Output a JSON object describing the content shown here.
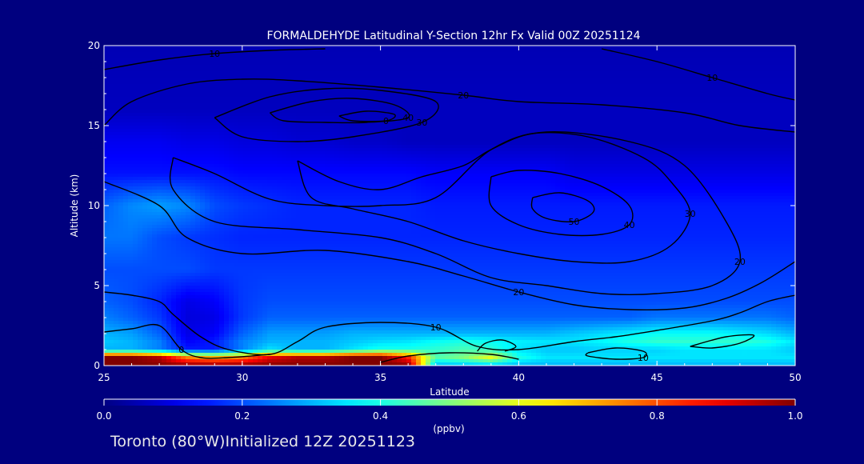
{
  "chart_data": {
    "type": "heatmap",
    "title": "FORMALDEHYDE Latitudinal Y-Section 12hr  Fx Valid 00Z 20251124",
    "xlabel": "Latitude",
    "ylabel": "Altitude (km)",
    "xlim": [
      25,
      50
    ],
    "ylim": [
      0,
      20
    ],
    "x_ticks": [
      "25",
      "30",
      "35",
      "40",
      "45",
      "50"
    ],
    "y_ticks": [
      "0",
      "5",
      "10",
      "15",
      "20"
    ],
    "x_tick_values": [
      25,
      30,
      35,
      40,
      45,
      50
    ],
    "y_tick_values": [
      0,
      5,
      10,
      15,
      20
    ],
    "colorbar": {
      "range": [
        0.0,
        1.0
      ],
      "ticks": [
        "0.0",
        "0.2",
        "0.4",
        "0.6",
        "0.8",
        "1.0"
      ],
      "tick_values": [
        0.0,
        0.2,
        0.4,
        0.6,
        0.8,
        1.0
      ],
      "unit_label": "(ppbv)"
    },
    "field": {
      "lat": [
        25,
        26,
        27,
        28,
        29,
        30,
        31,
        32,
        33,
        34,
        35,
        36,
        37,
        38,
        39,
        40,
        41,
        42,
        43,
        44,
        45,
        46,
        47,
        48,
        49,
        50
      ],
      "alt": [
        0,
        0.5,
        1,
        1.5,
        2,
        3,
        4,
        6,
        8,
        10,
        12,
        14,
        16,
        20
      ],
      "values": [
        [
          1.0,
          1.0,
          1.0,
          1.0,
          1.0,
          1.0,
          1.0,
          1.0,
          1.0,
          1.0,
          1.0,
          1.0,
          0.3,
          0.3,
          0.3,
          0.3,
          0.3,
          0.3,
          0.3,
          0.3,
          0.3,
          0.3,
          0.3,
          0.3,
          0.3,
          0.3
        ],
        [
          1.0,
          1.0,
          0.95,
          0.75,
          0.7,
          0.75,
          0.9,
          0.95,
          0.95,
          1.0,
          1.0,
          0.85,
          0.45,
          0.5,
          0.6,
          0.4,
          0.35,
          0.35,
          0.35,
          0.35,
          0.35,
          0.35,
          0.35,
          0.35,
          0.35,
          0.35
        ],
        [
          0.3,
          0.3,
          0.25,
          0.15,
          0.15,
          0.25,
          0.35,
          0.3,
          0.3,
          0.35,
          0.4,
          0.4,
          0.42,
          0.45,
          0.42,
          0.35,
          0.32,
          0.32,
          0.33,
          0.33,
          0.33,
          0.35,
          0.35,
          0.35,
          0.35,
          0.32
        ],
        [
          0.32,
          0.3,
          0.25,
          0.12,
          0.15,
          0.25,
          0.3,
          0.3,
          0.3,
          0.32,
          0.34,
          0.35,
          0.38,
          0.4,
          0.38,
          0.36,
          0.35,
          0.35,
          0.37,
          0.4,
          0.42,
          0.42,
          0.42,
          0.42,
          0.4,
          0.35
        ],
        [
          0.3,
          0.28,
          0.22,
          0.1,
          0.12,
          0.22,
          0.28,
          0.28,
          0.28,
          0.3,
          0.3,
          0.3,
          0.3,
          0.3,
          0.3,
          0.3,
          0.3,
          0.32,
          0.34,
          0.36,
          0.38,
          0.38,
          0.38,
          0.36,
          0.34,
          0.3
        ],
        [
          0.25,
          0.22,
          0.18,
          0.09,
          0.1,
          0.18,
          0.22,
          0.22,
          0.22,
          0.22,
          0.22,
          0.22,
          0.22,
          0.22,
          0.22,
          0.22,
          0.22,
          0.22,
          0.22,
          0.22,
          0.24,
          0.24,
          0.24,
          0.24,
          0.24,
          0.22
        ],
        [
          0.22,
          0.2,
          0.16,
          0.1,
          0.12,
          0.18,
          0.2,
          0.2,
          0.2,
          0.2,
          0.2,
          0.2,
          0.2,
          0.2,
          0.2,
          0.2,
          0.2,
          0.2,
          0.2,
          0.2,
          0.2,
          0.2,
          0.2,
          0.2,
          0.2,
          0.2
        ],
        [
          0.2,
          0.2,
          0.2,
          0.2,
          0.18,
          0.18,
          0.18,
          0.18,
          0.18,
          0.18,
          0.18,
          0.18,
          0.18,
          0.18,
          0.18,
          0.18,
          0.18,
          0.18,
          0.18,
          0.18,
          0.18,
          0.18,
          0.18,
          0.18,
          0.18,
          0.18
        ],
        [
          0.24,
          0.24,
          0.2,
          0.18,
          0.17,
          0.16,
          0.16,
          0.16,
          0.16,
          0.16,
          0.16,
          0.16,
          0.16,
          0.16,
          0.16,
          0.16,
          0.16,
          0.16,
          0.16,
          0.16,
          0.16,
          0.16,
          0.16,
          0.16,
          0.16,
          0.16
        ],
        [
          0.22,
          0.26,
          0.28,
          0.26,
          0.2,
          0.18,
          0.17,
          0.16,
          0.16,
          0.16,
          0.16,
          0.16,
          0.15,
          0.15,
          0.15,
          0.15,
          0.15,
          0.15,
          0.15,
          0.15,
          0.15,
          0.15,
          0.15,
          0.15,
          0.15,
          0.15
        ],
        [
          0.14,
          0.14,
          0.14,
          0.14,
          0.14,
          0.13,
          0.13,
          0.13,
          0.13,
          0.13,
          0.13,
          0.13,
          0.12,
          0.12,
          0.12,
          0.12,
          0.12,
          0.1,
          0.1,
          0.1,
          0.1,
          0.1,
          0.1,
          0.1,
          0.1,
          0.1
        ],
        [
          0.11,
          0.11,
          0.11,
          0.1,
          0.1,
          0.09,
          0.09,
          0.08,
          0.08,
          0.07,
          0.07,
          0.06,
          0.06,
          0.06,
          0.06,
          0.06,
          0.06,
          0.06,
          0.06,
          0.06,
          0.06,
          0.06,
          0.06,
          0.06,
          0.06,
          0.06
        ],
        [
          0.06,
          0.06,
          0.06,
          0.06,
          0.06,
          0.06,
          0.06,
          0.06,
          0.06,
          0.06,
          0.06,
          0.06,
          0.06,
          0.06,
          0.06,
          0.06,
          0.06,
          0.06,
          0.06,
          0.06,
          0.06,
          0.06,
          0.06,
          0.06,
          0.06,
          0.06
        ],
        [
          0.05,
          0.05,
          0.05,
          0.05,
          0.05,
          0.05,
          0.05,
          0.05,
          0.05,
          0.05,
          0.05,
          0.05,
          0.05,
          0.05,
          0.05,
          0.05,
          0.05,
          0.05,
          0.05,
          0.05,
          0.05,
          0.05,
          0.05,
          0.05,
          0.05,
          0.05
        ]
      ]
    },
    "contours": [
      {
        "label": "0",
        "points": [
          [
            25,
            2.1
          ],
          [
            26,
            2.3
          ],
          [
            27,
            2.5
          ],
          [
            27.8,
            1.0
          ],
          [
            28.5,
            0.5
          ],
          [
            29.5,
            0.5
          ],
          [
            31,
            0.7
          ]
        ]
      },
      {
        "label": "10",
        "points": [
          [
            25,
            4.6
          ],
          [
            26,
            4.4
          ],
          [
            27,
            4.0
          ],
          [
            27.5,
            3.2
          ],
          [
            28.5,
            1.8
          ],
          [
            29.5,
            1.0
          ],
          [
            31,
            0.7
          ],
          [
            32,
            1.5
          ],
          [
            33,
            2.4
          ],
          [
            35,
            2.7
          ],
          [
            37,
            2.4
          ],
          [
            38.5,
            1.2
          ],
          [
            40,
            1.0
          ],
          [
            42,
            1.5
          ],
          [
            43.5,
            1.8
          ],
          [
            45,
            2.2
          ],
          [
            47,
            2.8
          ],
          [
            48,
            3.3
          ],
          [
            49,
            4.0
          ],
          [
            50,
            4.4
          ]
        ]
      },
      {
        "label": "10",
        "points": [
          [
            25,
            18.5
          ],
          [
            27,
            19.1
          ],
          [
            29,
            19.5
          ],
          [
            31,
            19.7
          ],
          [
            33,
            19.8
          ]
        ]
      },
      {
        "label": "10",
        "points": [
          [
            43,
            19.8
          ],
          [
            45,
            19.0
          ],
          [
            47,
            18.0
          ],
          [
            49,
            17.0
          ],
          [
            50,
            16.6
          ]
        ]
      },
      {
        "label": "20",
        "points": [
          [
            25,
            11.5
          ],
          [
            27,
            10.0
          ],
          [
            28,
            8.0
          ],
          [
            30,
            7.0
          ],
          [
            33,
            7.2
          ],
          [
            36,
            6.5
          ],
          [
            38,
            5.6
          ],
          [
            40,
            4.6
          ],
          [
            42,
            3.8
          ],
          [
            44,
            3.5
          ],
          [
            46,
            3.6
          ],
          [
            47.5,
            4.2
          ],
          [
            48.8,
            5.2
          ],
          [
            50,
            6.5
          ]
        ]
      },
      {
        "label": "20",
        "points": [
          [
            25,
            15.0
          ],
          [
            26,
            16.5
          ],
          [
            28,
            17.6
          ],
          [
            30,
            17.9
          ],
          [
            32,
            17.8
          ],
          [
            35,
            17.4
          ],
          [
            38,
            16.9
          ],
          [
            40,
            16.5
          ],
          [
            43,
            16.3
          ],
          [
            46,
            15.8
          ],
          [
            48,
            15.0
          ],
          [
            50,
            14.6
          ]
        ]
      },
      {
        "label": "20",
        "points": [
          [
            27.5,
            13.0
          ],
          [
            29,
            12.0
          ],
          [
            31,
            10.4
          ],
          [
            33,
            10.0
          ],
          [
            35,
            10.0
          ],
          [
            37,
            10.5
          ],
          [
            39,
            13.5
          ],
          [
            41,
            14.6
          ],
          [
            44,
            14.0
          ],
          [
            46,
            12.5
          ],
          [
            47.5,
            9.0
          ],
          [
            48,
            6.5
          ],
          [
            47,
            5.0
          ],
          [
            45,
            4.5
          ],
          [
            43,
            4.5
          ],
          [
            41,
            5.0
          ],
          [
            39,
            5.5
          ],
          [
            37,
            7.0
          ],
          [
            35,
            8.0
          ],
          [
            32,
            8.5
          ],
          [
            29,
            9.0
          ],
          [
            27.5,
            11.0
          ],
          [
            27.5,
            13.0
          ]
        ]
      },
      {
        "label": "30",
        "points": [
          [
            32,
            12.8
          ],
          [
            33.5,
            11.5
          ],
          [
            35,
            11.0
          ],
          [
            36.5,
            11.8
          ],
          [
            38,
            12.5
          ],
          [
            39,
            13.5
          ],
          [
            40.5,
            14.5
          ],
          [
            42.5,
            14.3
          ],
          [
            44.5,
            13.0
          ],
          [
            45.5,
            11.5
          ],
          [
            46.2,
            9.5
          ],
          [
            45.5,
            7.5
          ],
          [
            44,
            6.5
          ],
          [
            42,
            6.5
          ],
          [
            40,
            7.0
          ],
          [
            38,
            7.8
          ],
          [
            36,
            9.0
          ],
          [
            34,
            9.8
          ],
          [
            32.5,
            10.5
          ],
          [
            32,
            12.8
          ]
        ]
      },
      {
        "label": "30",
        "points": [
          [
            29,
            15.5
          ],
          [
            31,
            16.8
          ],
          [
            33,
            17.3
          ],
          [
            35,
            17.2
          ],
          [
            37,
            16.5
          ],
          [
            36.5,
            15.2
          ],
          [
            34,
            14.3
          ],
          [
            32,
            14.0
          ],
          [
            30,
            14.3
          ],
          [
            29,
            15.5
          ]
        ]
      },
      {
        "label": "40",
        "points": [
          [
            39,
            11.8
          ],
          [
            40,
            12.2
          ],
          [
            41.5,
            12.0
          ],
          [
            43,
            11.2
          ],
          [
            44,
            10.0
          ],
          [
            44,
            8.8
          ],
          [
            43,
            8.2
          ],
          [
            41.5,
            8.2
          ],
          [
            40,
            8.8
          ],
          [
            39,
            10.0
          ],
          [
            39,
            11.8
          ]
        ]
      },
      {
        "label": "40",
        "points": [
          [
            31,
            15.8
          ],
          [
            32.5,
            16.5
          ],
          [
            34,
            16.7
          ],
          [
            35.5,
            16.3
          ],
          [
            36,
            15.5
          ],
          [
            34.5,
            15.2
          ],
          [
            33,
            15.2
          ],
          [
            31.5,
            15.3
          ],
          [
            31,
            15.8
          ]
        ]
      },
      {
        "label": "50",
        "points": [
          [
            40.5,
            10.5
          ],
          [
            41.5,
            10.8
          ],
          [
            42.5,
            10.3
          ],
          [
            42.7,
            9.6
          ],
          [
            42,
            9.0
          ],
          [
            41,
            9.2
          ],
          [
            40.5,
            9.8
          ],
          [
            40.5,
            10.5
          ]
        ]
      },
      {
        "label": "0",
        "points": [
          [
            33.5,
            15.6
          ],
          [
            34.5,
            15.9
          ],
          [
            35.5,
            15.7
          ],
          [
            35.2,
            15.3
          ],
          [
            34,
            15.3
          ],
          [
            33.5,
            15.6
          ]
        ]
      },
      {
        "label": "10",
        "points": [
          [
            42.5,
            0.8
          ],
          [
            43.5,
            1.1
          ],
          [
            44.5,
            0.9
          ],
          [
            44.5,
            0.5
          ],
          [
            43.5,
            0.4
          ],
          [
            42.5,
            0.6
          ],
          [
            42.5,
            0.8
          ]
        ]
      },
      {
        "label": "",
        "points": [
          [
            46.2,
            1.2
          ],
          [
            47.5,
            1.8
          ],
          [
            48.5,
            1.9
          ],
          [
            48,
            1.4
          ],
          [
            47,
            1.1
          ],
          [
            46.2,
            1.2
          ]
        ]
      },
      {
        "label": "",
        "points": [
          [
            35,
            0.2
          ],
          [
            36,
            0.6
          ],
          [
            37.5,
            0.8
          ],
          [
            39,
            0.7
          ],
          [
            40,
            0.4
          ]
        ]
      },
      {
        "label": "",
        "points": [
          [
            38.5,
            0.9
          ],
          [
            38.8,
            1.4
          ],
          [
            39.4,
            1.6
          ],
          [
            39.9,
            1.2
          ],
          [
            39.5,
            0.9
          ]
        ]
      }
    ]
  },
  "footer": {
    "location": "Toronto (80°W)",
    "initialized": "Initialized 12Z 20251123"
  }
}
